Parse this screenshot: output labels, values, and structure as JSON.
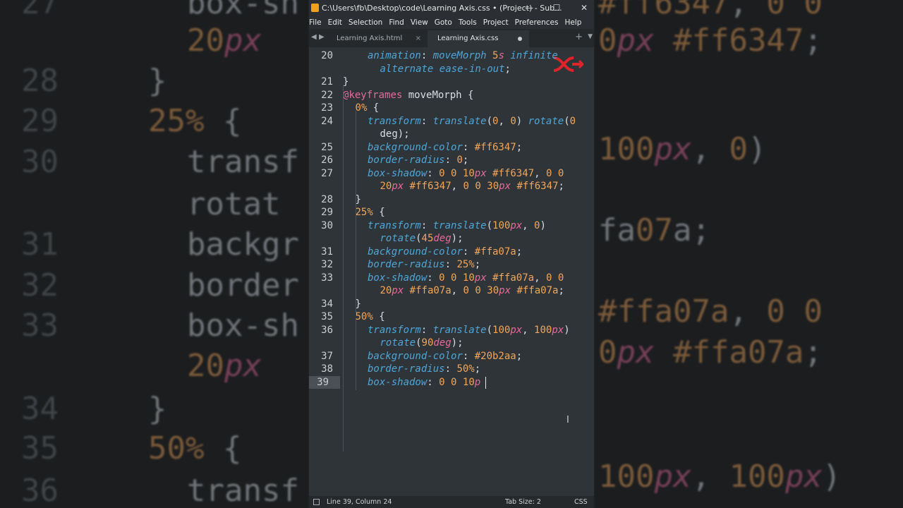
{
  "window": {
    "title": "C:\\Users\\fb\\Desktop\\code\\Learning Axis.css • (Project) - Sub...",
    "minimize": "—",
    "maximize": "☐",
    "close": "✕"
  },
  "menu": [
    "File",
    "Edit",
    "Selection",
    "Find",
    "View",
    "Goto",
    "Tools",
    "Project",
    "Preferences",
    "Help"
  ],
  "tabs": [
    {
      "label": "Learning Axis.html",
      "close": "×",
      "active": false
    },
    {
      "label": "Learning Axis.css",
      "close": "●",
      "active": true
    }
  ],
  "tab_controls": {
    "back": "◀",
    "forward": "▶",
    "new": "+",
    "more": "▼"
  },
  "editor": {
    "current_line": "39",
    "lines": [
      {
        "num": "20",
        "rows": [
          "animation: moveMorph 5s infinite",
          "alternate ease-in-out;"
        ]
      },
      {
        "num": "21",
        "rows": [
          "}"
        ]
      },
      {
        "num": "22",
        "rows": [
          "@keyframes moveMorph {"
        ]
      },
      {
        "num": "23",
        "rows": [
          "0% {"
        ]
      },
      {
        "num": "24",
        "rows": [
          "transform: translate(0, 0) rotate(0",
          "deg);"
        ]
      },
      {
        "num": "25",
        "rows": [
          "background-color: #ff6347;"
        ]
      },
      {
        "num": "26",
        "rows": [
          "border-radius: 0;"
        ]
      },
      {
        "num": "27",
        "rows": [
          "box-shadow: 0 0 10px #ff6347, 0 0",
          "20px #ff6347, 0 0 30px #ff6347;"
        ]
      },
      {
        "num": "28",
        "rows": [
          "}"
        ]
      },
      {
        "num": "29",
        "rows": [
          "25% {"
        ]
      },
      {
        "num": "30",
        "rows": [
          "transform: translate(100px, 0)",
          "rotate(45deg);"
        ]
      },
      {
        "num": "31",
        "rows": [
          "background-color: #ffa07a;"
        ]
      },
      {
        "num": "32",
        "rows": [
          "border-radius: 25%;"
        ]
      },
      {
        "num": "33",
        "rows": [
          "box-shadow: 0 0 10px #ffa07a, 0 0",
          "20px #ffa07a, 0 0 30px #ffa07a;"
        ]
      },
      {
        "num": "34",
        "rows": [
          "}"
        ]
      },
      {
        "num": "35",
        "rows": [
          "50% {"
        ]
      },
      {
        "num": "36",
        "rows": [
          "transform: translate(100px, 100px)",
          "rotate(90deg);"
        ]
      },
      {
        "num": "37",
        "rows": [
          "background-color: #20b2aa;"
        ]
      },
      {
        "num": "38",
        "rows": [
          "border-radius: 50%;"
        ]
      },
      {
        "num": "39",
        "rows": [
          "box-shadow: 0 0 10p"
        ]
      }
    ]
  },
  "background_lines": [
    {
      "num": "27",
      "code": "box-sh"
    },
    {
      "num": "",
      "code": "20px"
    },
    {
      "num": "28",
      "code": "}"
    },
    {
      "num": "29",
      "code": "25% {"
    },
    {
      "num": "30",
      "code": "transf"
    },
    {
      "num": "",
      "code": "rotat"
    },
    {
      "num": "31",
      "code": "backgr"
    },
    {
      "num": "32",
      "code": "border"
    },
    {
      "num": "33",
      "code": "box-sh"
    },
    {
      "num": "",
      "code": "20px"
    },
    {
      "num": "34",
      "code": "}"
    },
    {
      "num": "35",
      "code": "50% {"
    },
    {
      "num": "36",
      "code": "transf"
    }
  ],
  "background_right": [
    "#ff6347, 0 0",
    "0px #ff6347;",
    "100px, 0)",
    "fa07a;",
    "#ffa07a, 0 0",
    "0px #ffa07a;",
    "100px, 100px)"
  ],
  "status": {
    "position": "Line 39, Column 24",
    "tab_size": "Tab Size: 2",
    "syntax": "CSS"
  },
  "colors": {
    "accent_logo": "#e0242b",
    "property": "#4ea6d8",
    "number": "#f2a65a",
    "unit": "#e76a9b",
    "editor_bg": "#2f3438"
  }
}
